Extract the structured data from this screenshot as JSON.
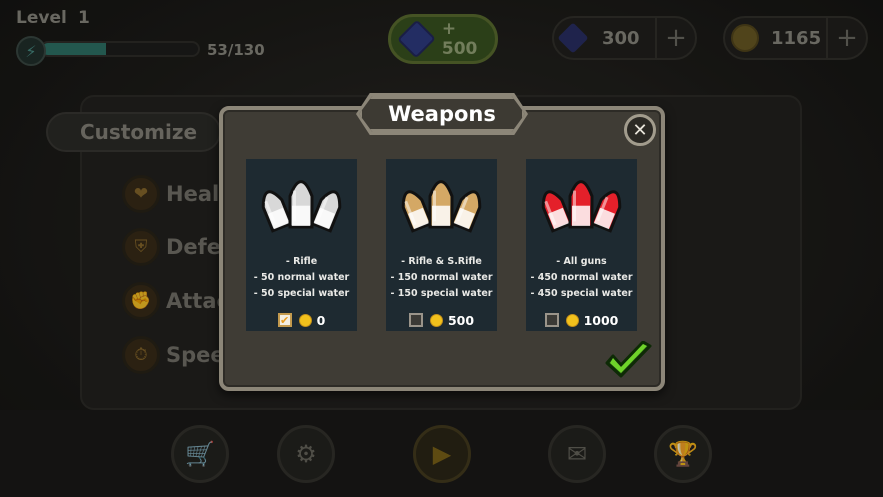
{
  "player": {
    "level_label": "Level",
    "level_value": "1",
    "xp_text": "53/130",
    "xp_progress": 0.41
  },
  "currency": {
    "gem_bonus": "+ 500",
    "gems": "300",
    "coins": "1165"
  },
  "background_menu": {
    "customize": "Customize",
    "stats": [
      "Healt",
      "Defe",
      "Attac",
      "Spee"
    ]
  },
  "modal": {
    "title": "Weapons",
    "close_icon": "close-icon",
    "confirm_icon": "checkmark-icon",
    "options": [
      {
        "lines": [
          "- Rifle",
          "- 50 normal water",
          "- 50 special water"
        ],
        "price": "0",
        "selected": true,
        "color": "#d8d8d8"
      },
      {
        "lines": [
          "- Rifle & S.Rifle",
          "- 150 normal water",
          "- 150 special water"
        ],
        "price": "500",
        "selected": false,
        "color": "#d4a865"
      },
      {
        "lines": [
          "- All guns",
          "- 450 normal water",
          "- 450 special water"
        ],
        "price": "1000",
        "selected": false,
        "color": "#e4202a"
      }
    ]
  },
  "bottom_nav": [
    "cart-icon",
    "gear-icon",
    "play-icon",
    "mail-icon",
    "trophy-icon"
  ]
}
